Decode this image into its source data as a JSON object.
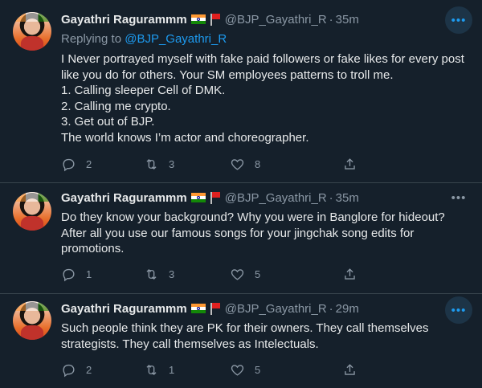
{
  "tweets": [
    {
      "name": "Gayathri Ragurammm",
      "handle": "@BJP_Gayathri_R",
      "dot": "·",
      "time": "35m",
      "replying_prefix": "Replying to ",
      "replying_to": "@BJP_Gayathri_R",
      "lines": [
        "I Never portrayed myself with fake paid followers or fake likes for every post",
        "like you do for others. Your SM employees patterns to troll me.",
        "1. Calling sleeper Cell of DMK.",
        "2. Calling me crypto.",
        "3. Get out of BJP.",
        "The world knows I’m actor and choreographer."
      ],
      "replies": "2",
      "retweets": "3",
      "likes": "8"
    },
    {
      "name": "Gayathri Ragurammm",
      "handle": "@BJP_Gayathri_R",
      "dot": "·",
      "time": "35m",
      "lines": [
        "Do they know your background? Why you were in Banglore for hideout?",
        "After all you use our famous songs for your jingchak song edits for",
        "promotions."
      ],
      "replies": "1",
      "retweets": "3",
      "likes": "5"
    },
    {
      "name": "Gayathri Ragurammm",
      "handle": "@BJP_Gayathri_R",
      "dot": "·",
      "time": "29m",
      "lines": [
        "Such people think they are PK for their owners. They call themselves",
        "strategists. They call themselves as Intelectuals."
      ],
      "replies": "2",
      "retweets": "1",
      "likes": "5"
    }
  ],
  "icons": {
    "more": "more-icon",
    "reply": "reply-icon",
    "retweet": "retweet-icon",
    "like": "like-icon",
    "share": "share-icon"
  },
  "more_glyph": "•••",
  "colors": {
    "background": "#15202b",
    "accent": "#1d9bf0",
    "muted": "#8b98a5",
    "text": "#e7e9ea"
  }
}
